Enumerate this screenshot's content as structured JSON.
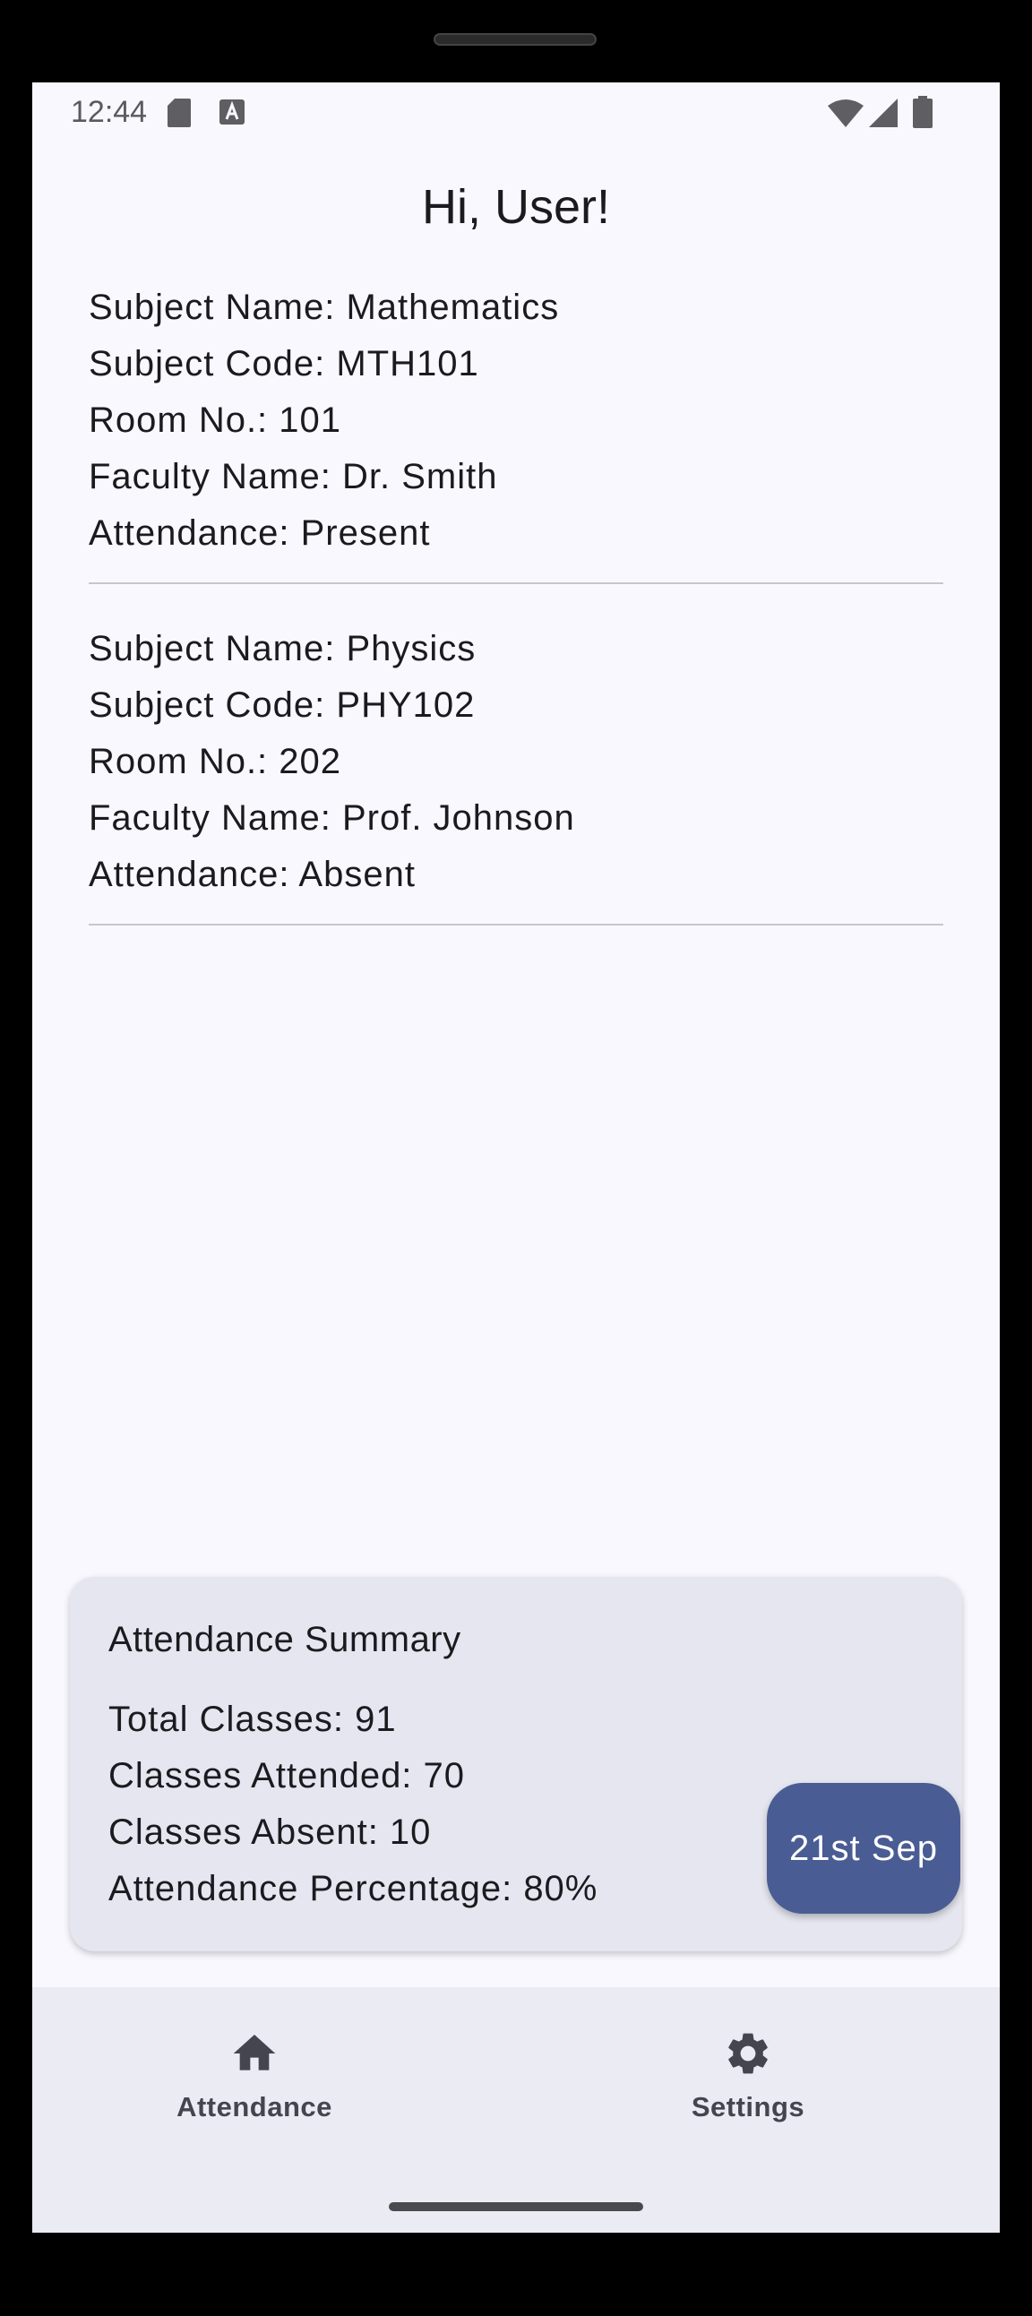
{
  "status_bar": {
    "time": "12:44",
    "icons": [
      "sd-card-icon",
      "keyboard-a-icon",
      "wifi-icon",
      "signal-icon",
      "battery-icon"
    ]
  },
  "greeting": "Hi, User!",
  "subjects": [
    {
      "name_line": "Subject Name: Mathematics",
      "code_line": "Subject Code: MTH101",
      "room_line": "Room No.: 101",
      "faculty_line": "Faculty Name: Dr. Smith",
      "attendance_line": "Attendance: Present"
    },
    {
      "name_line": "Subject Name: Physics",
      "code_line": "Subject Code: PHY102",
      "room_line": "Room No.: 202",
      "faculty_line": "Faculty Name: Prof. Johnson",
      "attendance_line": "Attendance: Absent"
    }
  ],
  "summary": {
    "title": "Attendance Summary",
    "total_line": "Total Classes: 91",
    "attended_line": "Classes Attended: 70",
    "absent_line": "Classes Absent: 10",
    "percentage_line": "Attendance Percentage: 80%",
    "date_button": "21st Sep"
  },
  "nav": {
    "items": [
      {
        "label": "Attendance",
        "icon": "home-icon"
      },
      {
        "label": "Settings",
        "icon": "gear-icon"
      }
    ]
  },
  "colors": {
    "background": "#f9f8fe",
    "card": "#e6e6f0",
    "accent": "#4a5c94",
    "nav_background": "#ebebf3",
    "text": "#1b1b1f"
  }
}
